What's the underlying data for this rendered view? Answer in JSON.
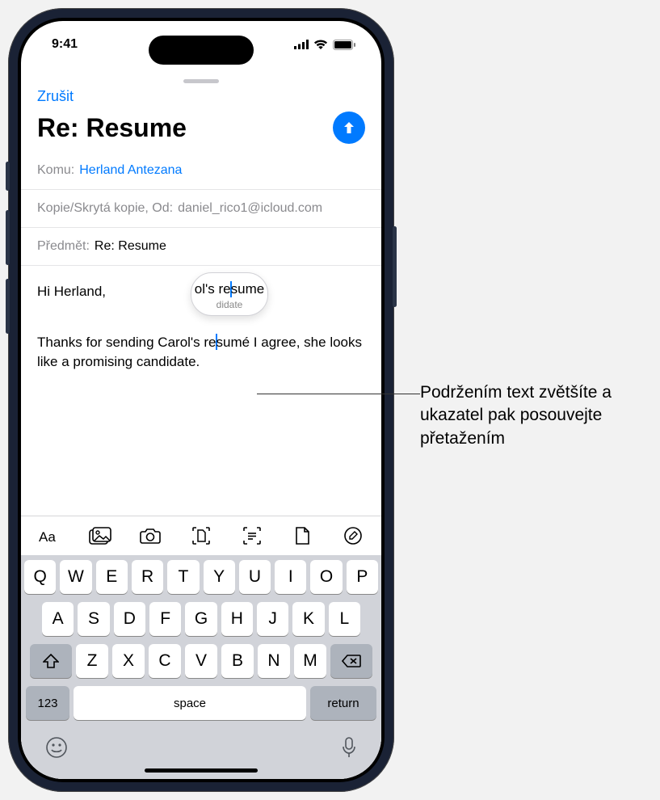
{
  "status": {
    "time": "9:41"
  },
  "compose": {
    "cancel": "Zrušit",
    "title": "Re: Resume",
    "to_label": "Komu:",
    "to_value": "Herland Antezana",
    "cc_label": "Kopie/Skrytá kopie, Od:",
    "cc_value": "daniel_rico1@icloud.com",
    "subject_label": "Předmět:",
    "subject_value": "Re: Resume",
    "body_greeting": "Hi Herland,",
    "body_before_cursor": "Thanks for sending Carol's re",
    "body_after_cursor": "sumé I agree, she looks like a promising candidate.",
    "loupe_before": "ol's re",
    "loupe_after": "sume",
    "loupe_line2": "didate"
  },
  "keyboard": {
    "row1": [
      "Q",
      "W",
      "E",
      "R",
      "T",
      "Y",
      "U",
      "I",
      "O",
      "P"
    ],
    "row2": [
      "A",
      "S",
      "D",
      "F",
      "G",
      "H",
      "J",
      "K",
      "L"
    ],
    "row3": [
      "Z",
      "X",
      "C",
      "V",
      "B",
      "N",
      "M"
    ],
    "numbers": "123",
    "space": "space",
    "return": "return"
  },
  "callout": "Podržením text zvětšíte a ukazatel pak posouvejte přetažením"
}
